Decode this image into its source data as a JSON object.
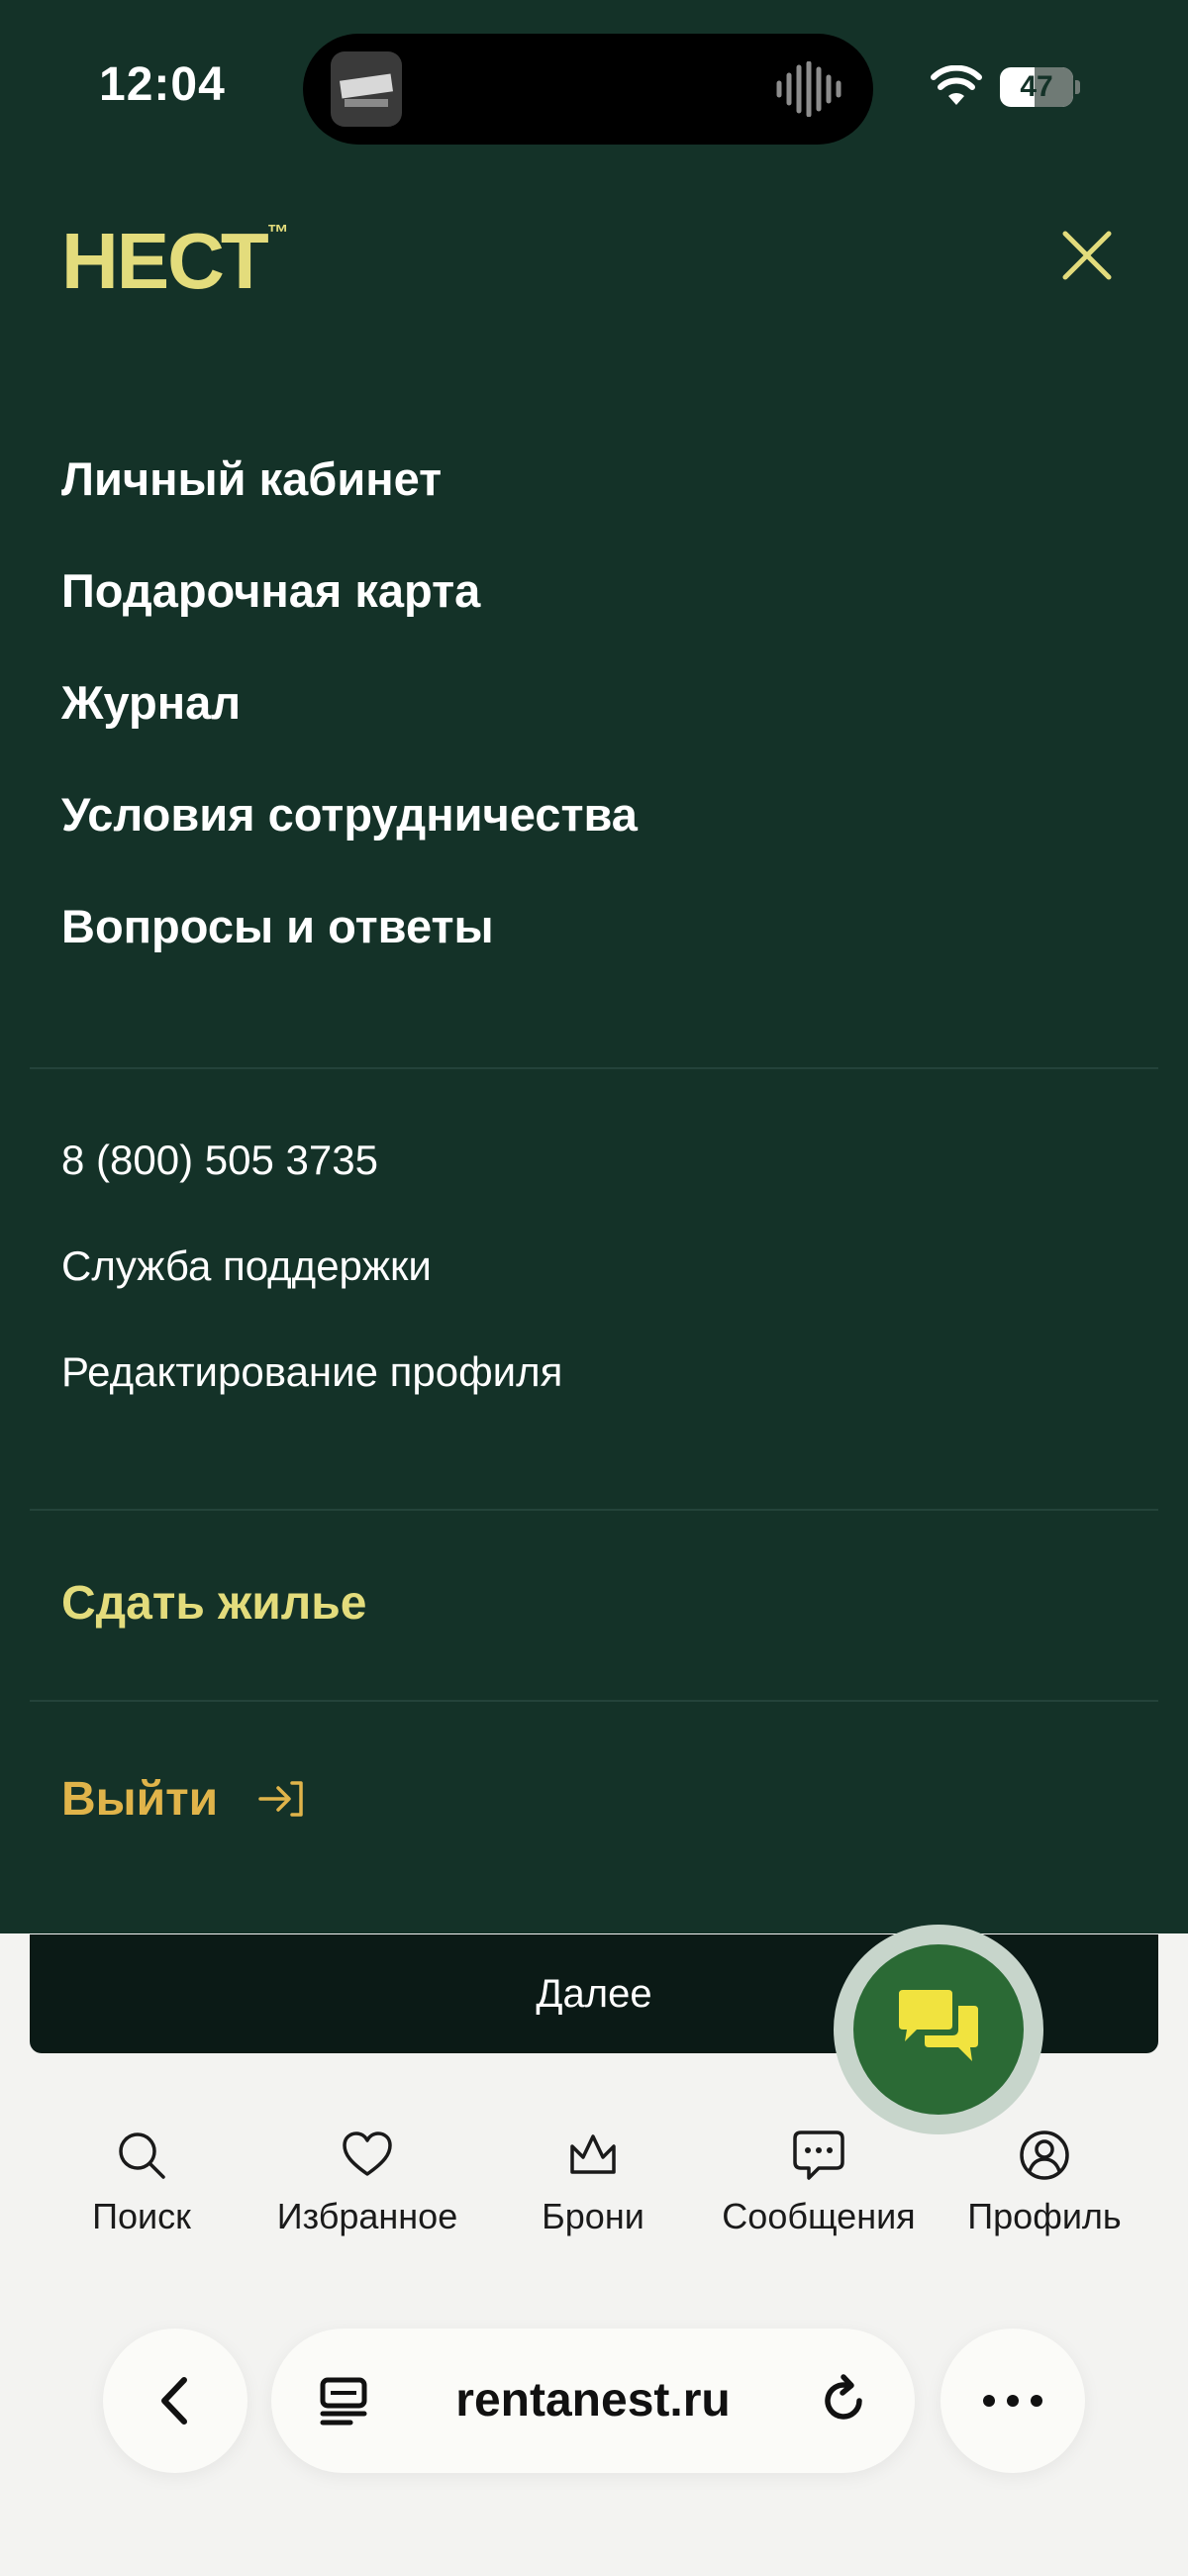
{
  "status_bar": {
    "time": "12:04",
    "battery_level": "47",
    "battery_fraction": 0.47
  },
  "header": {
    "logo_text": "НЕСТ",
    "logo_mark": "™",
    "close_icon": "close-icon"
  },
  "menu": {
    "primary_items": [
      {
        "label": "Личный кабинет"
      },
      {
        "label": "Подарочная карта"
      },
      {
        "label": "Журнал"
      },
      {
        "label": "Условия сотрудничества"
      },
      {
        "label": "Вопросы и ответы"
      }
    ],
    "secondary_items": [
      {
        "label": "8 (800) 505 3735"
      },
      {
        "label": "Служба поддержки"
      },
      {
        "label": "Редактирование профиля"
      }
    ],
    "rent_out_label": "Сдать жилье",
    "logout_label": "Выйти"
  },
  "next_button_label": "Далее",
  "chat_fab_icon": "chat-icon",
  "bottom_nav": [
    {
      "label": "Поиск",
      "icon": "search-icon"
    },
    {
      "label": "Избранное",
      "icon": "heart-icon"
    },
    {
      "label": "Брони",
      "icon": "crown-icon"
    },
    {
      "label": "Сообщения",
      "icon": "message-icon"
    },
    {
      "label": "Профиль",
      "icon": "profile-icon"
    }
  ],
  "browser": {
    "url": "rentanest.ru"
  },
  "colors": {
    "panel_bg": "#143228",
    "accent_yellow": "#e3dc7c",
    "logout_gold": "#e0b44a",
    "fab_green": "#2b6a35"
  }
}
